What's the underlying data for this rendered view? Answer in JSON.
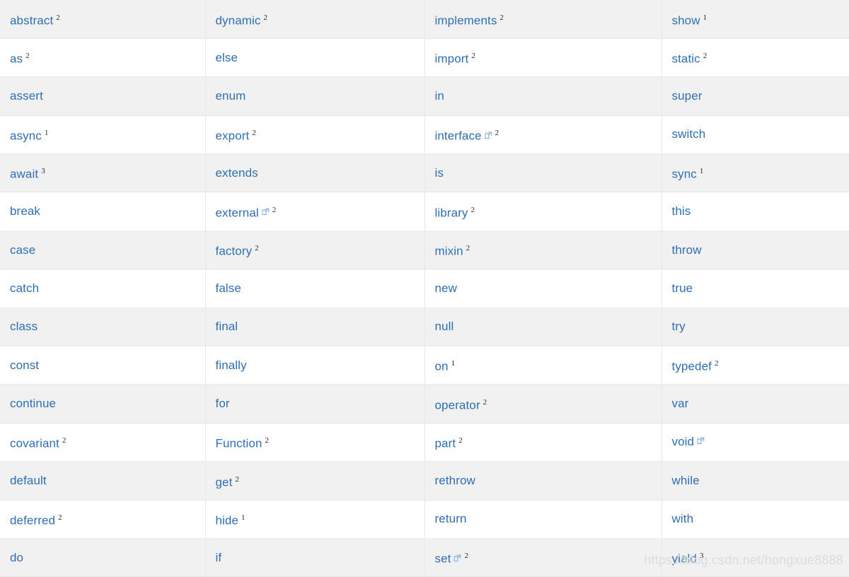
{
  "table": {
    "columns": 4,
    "colors": {
      "link": "#2f6eb5",
      "row_odd_bg": "#f1f1f1",
      "row_even_bg": "#ffffff",
      "border": "#e4e8ec",
      "superscript": "#24292e",
      "watermark": "#dcdcdc"
    },
    "icon_names": {
      "external_link": "external-link-icon"
    },
    "rows": [
      [
        {
          "label": "abstract",
          "sup": "2",
          "ext": false
        },
        {
          "label": "dynamic",
          "sup": "2",
          "ext": false
        },
        {
          "label": "implements",
          "sup": "2",
          "ext": false
        },
        {
          "label": "show",
          "sup": "1",
          "ext": false
        }
      ],
      [
        {
          "label": "as",
          "sup": "2",
          "ext": false
        },
        {
          "label": "else",
          "sup": "",
          "ext": false
        },
        {
          "label": "import",
          "sup": "2",
          "ext": false
        },
        {
          "label": "static",
          "sup": "2",
          "ext": false
        }
      ],
      [
        {
          "label": "assert",
          "sup": "",
          "ext": false
        },
        {
          "label": "enum",
          "sup": "",
          "ext": false
        },
        {
          "label": "in",
          "sup": "",
          "ext": false
        },
        {
          "label": "super",
          "sup": "",
          "ext": false
        }
      ],
      [
        {
          "label": "async",
          "sup": "1",
          "ext": false
        },
        {
          "label": "export",
          "sup": "2",
          "ext": false
        },
        {
          "label": "interface",
          "sup": "2",
          "ext": true
        },
        {
          "label": "switch",
          "sup": "",
          "ext": false
        }
      ],
      [
        {
          "label": "await",
          "sup": "3",
          "ext": false
        },
        {
          "label": "extends",
          "sup": "",
          "ext": false
        },
        {
          "label": "is",
          "sup": "",
          "ext": false
        },
        {
          "label": "sync",
          "sup": "1",
          "ext": false
        }
      ],
      [
        {
          "label": "break",
          "sup": "",
          "ext": false
        },
        {
          "label": "external",
          "sup": "2",
          "ext": true
        },
        {
          "label": "library",
          "sup": "2",
          "ext": false
        },
        {
          "label": "this",
          "sup": "",
          "ext": false
        }
      ],
      [
        {
          "label": "case",
          "sup": "",
          "ext": false
        },
        {
          "label": "factory",
          "sup": "2",
          "ext": false
        },
        {
          "label": "mixin",
          "sup": "2",
          "ext": false
        },
        {
          "label": "throw",
          "sup": "",
          "ext": false
        }
      ],
      [
        {
          "label": "catch",
          "sup": "",
          "ext": false
        },
        {
          "label": "false",
          "sup": "",
          "ext": false
        },
        {
          "label": "new",
          "sup": "",
          "ext": false
        },
        {
          "label": "true",
          "sup": "",
          "ext": false
        }
      ],
      [
        {
          "label": "class",
          "sup": "",
          "ext": false
        },
        {
          "label": "final",
          "sup": "",
          "ext": false
        },
        {
          "label": "null",
          "sup": "",
          "ext": false
        },
        {
          "label": "try",
          "sup": "",
          "ext": false
        }
      ],
      [
        {
          "label": "const",
          "sup": "",
          "ext": false
        },
        {
          "label": "finally",
          "sup": "",
          "ext": false
        },
        {
          "label": "on",
          "sup": "1",
          "ext": false
        },
        {
          "label": "typedef",
          "sup": "2",
          "ext": false
        }
      ],
      [
        {
          "label": "continue",
          "sup": "",
          "ext": false
        },
        {
          "label": "for",
          "sup": "",
          "ext": false
        },
        {
          "label": "operator",
          "sup": "2",
          "ext": false
        },
        {
          "label": "var",
          "sup": "",
          "ext": false
        }
      ],
      [
        {
          "label": "covariant",
          "sup": "2",
          "ext": false
        },
        {
          "label": "Function",
          "sup": "2",
          "ext": false
        },
        {
          "label": "part",
          "sup": "2",
          "ext": false
        },
        {
          "label": "void",
          "sup": "",
          "ext": true
        }
      ],
      [
        {
          "label": "default",
          "sup": "",
          "ext": false
        },
        {
          "label": "get",
          "sup": "2",
          "ext": false
        },
        {
          "label": "rethrow",
          "sup": "",
          "ext": false
        },
        {
          "label": "while",
          "sup": "",
          "ext": false
        }
      ],
      [
        {
          "label": "deferred",
          "sup": "2",
          "ext": false
        },
        {
          "label": "hide",
          "sup": "1",
          "ext": false
        },
        {
          "label": "return",
          "sup": "",
          "ext": false
        },
        {
          "label": "with",
          "sup": "",
          "ext": false
        }
      ],
      [
        {
          "label": "do",
          "sup": "",
          "ext": false
        },
        {
          "label": "if",
          "sup": "",
          "ext": false
        },
        {
          "label": "set",
          "sup": "2",
          "ext": true
        },
        {
          "label": "yield",
          "sup": "3",
          "ext": false
        }
      ]
    ]
  },
  "watermark": {
    "text": "https://blog.csdn.net/hongxue8888"
  }
}
